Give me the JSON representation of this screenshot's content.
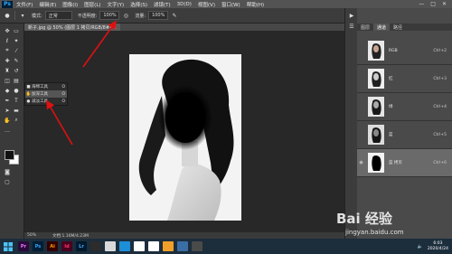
{
  "app": {
    "logo": "Ps"
  },
  "menu": [
    "文件(F)",
    "编辑(E)",
    "图像(I)",
    "图层(L)",
    "文字(Y)",
    "选择(S)",
    "滤镜(T)",
    "3D(D)",
    "视图(V)",
    "窗口(W)",
    "帮助(H)"
  ],
  "window_controls": {
    "minimize": "—",
    "maximize": "□",
    "close": "✕"
  },
  "options": {
    "mode_label": "模式:",
    "mode_value": "正常",
    "opacity_label": "不透明度:",
    "opacity_value": "100%",
    "flow_label": "流量:",
    "flow_value": "100%"
  },
  "document": {
    "tab": "新子.jpg @ 50% (图层 1 拷贝/RGB/8#) ×"
  },
  "flyout": [
    {
      "icon": "sponge-icon",
      "label": "海绵工具",
      "key": "O"
    },
    {
      "icon": "burn-icon",
      "label": "加深工具",
      "key": "O"
    },
    {
      "icon": "dodge-icon",
      "label": "减淡工具",
      "key": "O"
    }
  ],
  "status": {
    "zoom": "50%",
    "doc": "文档:1.16M/4.23M"
  },
  "panel": {
    "tabs": [
      "图层",
      "通道",
      "路径"
    ]
  },
  "layers": [
    {
      "name": "RGB",
      "key": "Ctrl+2",
      "selected": false
    },
    {
      "name": "红",
      "key": "Ctrl+3",
      "selected": false
    },
    {
      "name": "绿",
      "key": "Ctrl+4",
      "selected": false
    },
    {
      "name": "蓝",
      "key": "Ctrl+5",
      "selected": false
    },
    {
      "name": "蓝 拷贝",
      "key": "Ctrl+6",
      "selected": true
    }
  ],
  "taskbar": {
    "apps": [
      {
        "name": "Pr",
        "color": "#2a0a3a",
        "fg": "#ea77ff"
      },
      {
        "name": "Ps",
        "color": "#001e36",
        "fg": "#31a8ff"
      },
      {
        "name": "Ai",
        "color": "#330000",
        "fg": "#ff9a00"
      },
      {
        "name": "Id",
        "color": "#49021f",
        "fg": "#ff3366"
      },
      {
        "name": "Lr",
        "color": "#001a2e",
        "fg": "#4fa8ff"
      },
      {
        "name": "",
        "color": "#2c2c2c",
        "fg": "#ffffff"
      },
      {
        "name": "",
        "color": "#d9d9d9",
        "fg": "#333333"
      },
      {
        "name": "",
        "color": "#1d8fd8",
        "fg": "#ffffff"
      },
      {
        "name": "",
        "color": "#ffffff",
        "fg": "#1aad19"
      },
      {
        "name": "",
        "color": "#ffffff",
        "fg": "#e33"
      },
      {
        "name": "",
        "color": "#f0a02a",
        "fg": "#ffffff"
      },
      {
        "name": "",
        "color": "#3a6ea5",
        "fg": "#ffffff"
      },
      {
        "name": "",
        "color": "#4a4a4a",
        "fg": "#ffffff"
      }
    ],
    "time": "6:03",
    "date": "2020/4/24"
  },
  "watermark": {
    "main": "Bai 经验",
    "sub": "jingyan.baidu.com"
  }
}
